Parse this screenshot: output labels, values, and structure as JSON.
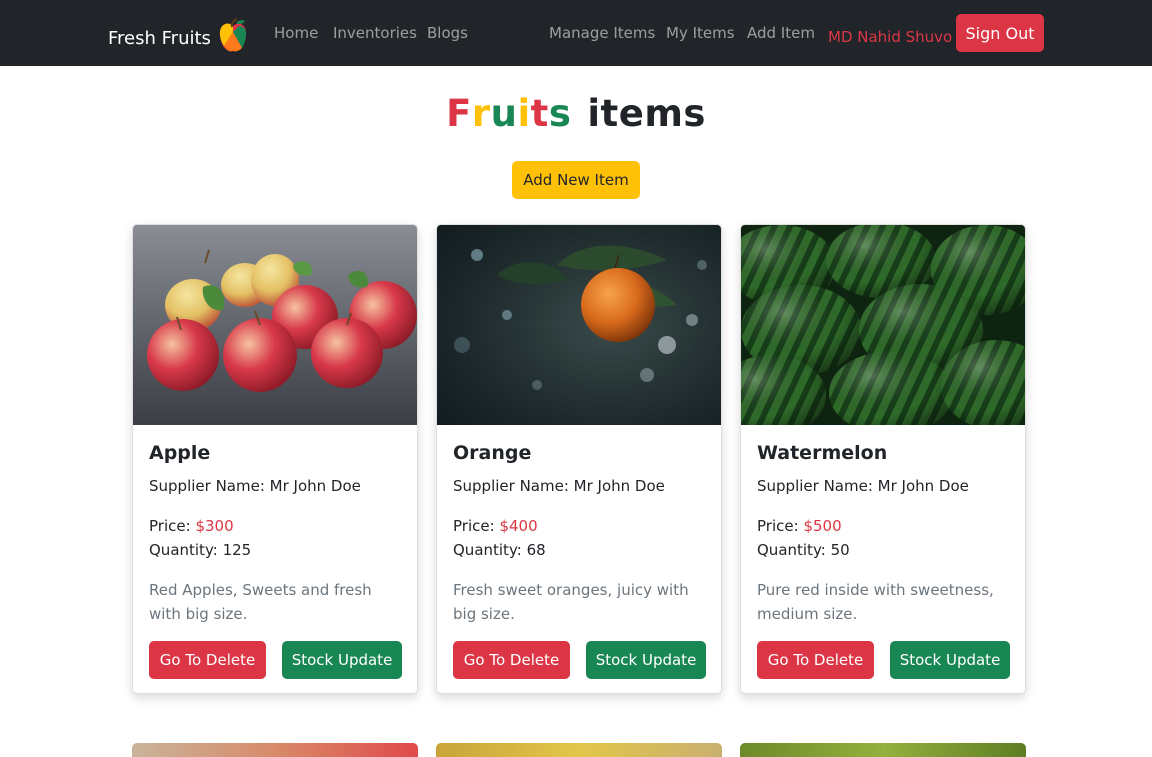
{
  "nav": {
    "brand": "Fresh Fruits",
    "brand_icon": "apple-logo-icon",
    "links": [
      "Home",
      "Inventories",
      "Blogs",
      "Manage Items",
      "My Items",
      "Add Item"
    ],
    "user": "MD Nahid Shuvo",
    "sign_out": "Sign Out"
  },
  "heading": {
    "letters": [
      "F",
      "r",
      "u",
      "i",
      "t",
      "s"
    ],
    "letter_colors": [
      "#dc3545",
      "#ffc107",
      "#198754",
      "#ffc107",
      "#dc3545",
      "#198754"
    ],
    "rest": "items"
  },
  "add_button": "Add New Item",
  "cards": [
    {
      "name": "Apple",
      "supplier_label": "Supplier Name:",
      "supplier": "Mr John Doe",
      "price_label": "Price:",
      "price": "$300",
      "qty_label": "Quantity:",
      "qty": "125",
      "desc": "Red Apples, Sweets and fresh with big size.",
      "delete_label": "Go To Delete",
      "stock_label": "Stock Update"
    },
    {
      "name": "Orange",
      "supplier_label": "Supplier Name:",
      "supplier": "Mr John Doe",
      "price_label": "Price:",
      "price": "$400",
      "qty_label": "Quantity:",
      "qty": "68",
      "desc": "Fresh sweet oranges, juicy with big size.",
      "delete_label": "Go To Delete",
      "stock_label": "Stock Update"
    },
    {
      "name": "Watermelon",
      "supplier_label": "Supplier Name:",
      "supplier": "Mr John Doe",
      "price_label": "Price:",
      "price": "$500",
      "qty_label": "Quantity:",
      "qty": "50",
      "desc": "Pure red inside with sweetness, medium size.",
      "delete_label": "Go To Delete",
      "stock_label": "Stock Update"
    }
  ],
  "colors": {
    "navbar_bg": "#212529",
    "danger": "#dc3545",
    "success": "#198754",
    "warning": "#ffc107",
    "muted": "#6c757d"
  }
}
